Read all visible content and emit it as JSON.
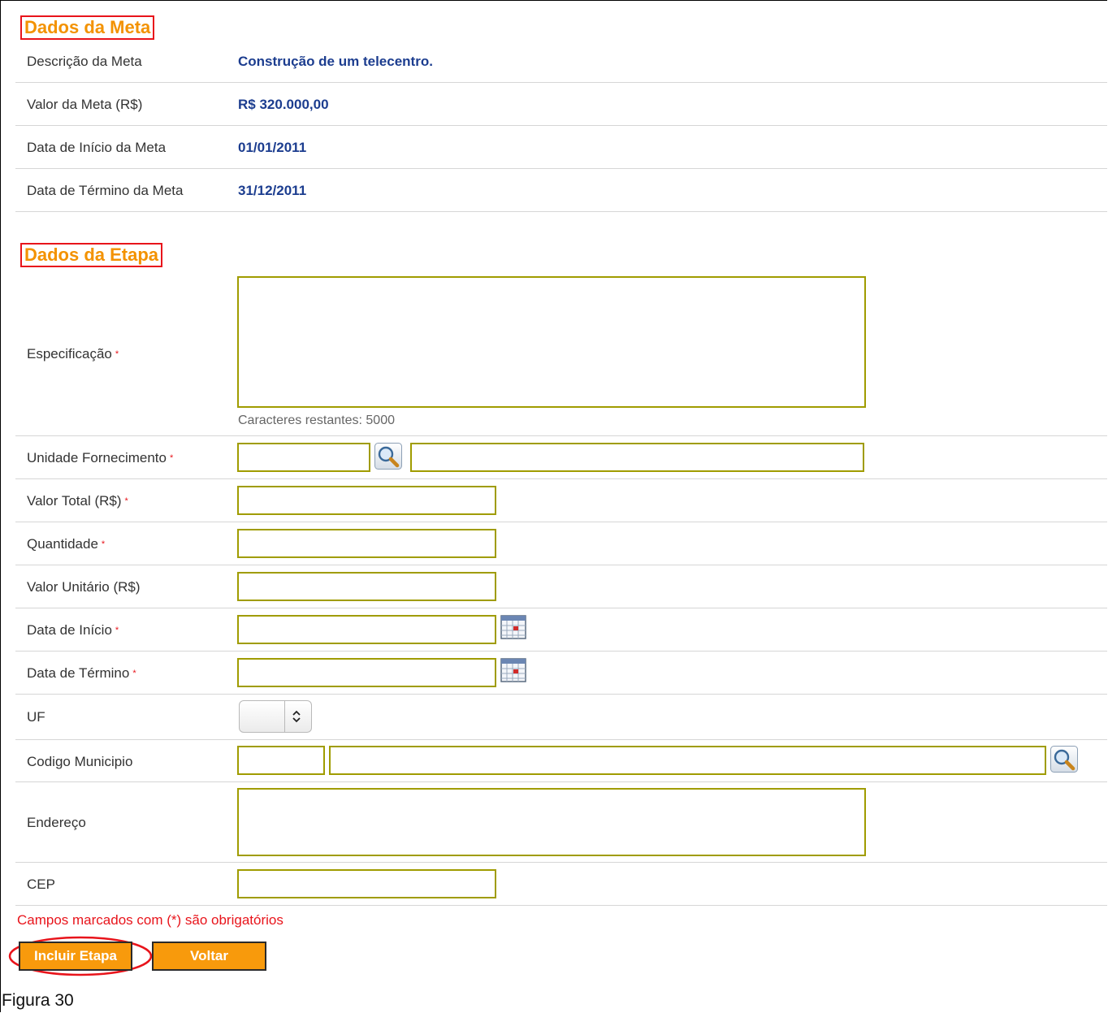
{
  "meta_section": {
    "title": "Dados da Meta",
    "rows": [
      {
        "label": "Descrição da Meta",
        "value": "Construção de um telecentro."
      },
      {
        "label": "Valor da Meta (R$)",
        "value": "R$ 320.000,00"
      },
      {
        "label": "Data de Início da Meta",
        "value": "01/01/2011"
      },
      {
        "label": "Data de Término da Meta",
        "value": "31/12/2011"
      }
    ]
  },
  "etapa_section": {
    "title": "Dados da Etapa",
    "especificacao": {
      "label": "Especificação",
      "value": "",
      "remaining_text": "Caracteres restantes: 5000"
    },
    "unidade_fornecimento": {
      "label": "Unidade Fornecimento",
      "code": "",
      "description": ""
    },
    "valor_total": {
      "label": "Valor Total (R$)",
      "value": ""
    },
    "quantidade": {
      "label": "Quantidade",
      "value": ""
    },
    "valor_unitario": {
      "label": "Valor Unitário (R$)",
      "value": ""
    },
    "data_inicio": {
      "label": "Data de Início",
      "value": ""
    },
    "data_termino": {
      "label": "Data de Término",
      "value": ""
    },
    "uf": {
      "label": "UF",
      "selected": ""
    },
    "codigo_municipio": {
      "label": "Codigo Municipio",
      "code": "",
      "name": ""
    },
    "endereco": {
      "label": "Endereço",
      "value": ""
    },
    "cep": {
      "label": "CEP",
      "value": ""
    }
  },
  "required_marker": "*",
  "required_notice": "Campos marcados com (*) são obrigatórios",
  "buttons": {
    "incluir": "Incluir Etapa",
    "voltar": "Voltar"
  },
  "caption": "Figura 30",
  "icons": {
    "search": "magnifier-icon",
    "calendar": "calendar-icon"
  },
  "colors": {
    "section_title": "#f39200",
    "highlight_border": "#e8141b",
    "value_text": "#1c3d8f",
    "field_border": "#a09c00",
    "button_bg": "#f89a0c",
    "required": "#e8141b"
  }
}
